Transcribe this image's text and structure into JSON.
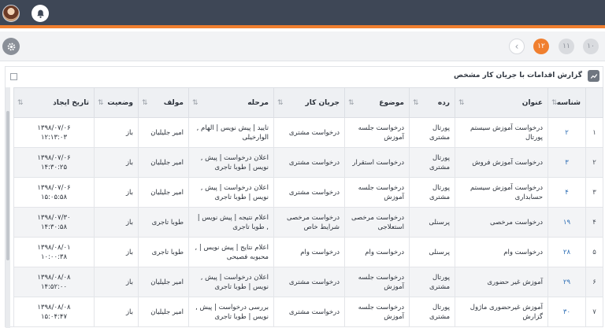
{
  "header": {
    "avatar_icon": "user-avatar-icon",
    "notification_icon": "bell-icon"
  },
  "toolbar": {
    "settings_icon": "gear-icon",
    "pagination": {
      "back": "‹",
      "pages": [
        "۱۲",
        "۱۱",
        "۱۰"
      ],
      "active_page": "۱۲"
    }
  },
  "report": {
    "title": "گزارش اقدامات با جریان کار مشخص",
    "columns": {
      "id": "شناسه",
      "title": "عنوان",
      "category": "رده",
      "subject": "موضوع",
      "workflow": "جریان کار",
      "stage": "مرحله",
      "author": "مولف",
      "status": "وضعیت",
      "created": "تاریخ ایجاد"
    },
    "rows": [
      {
        "rn": "۱",
        "id": "۲",
        "title": "درخواست آموزش سیستم پورتال",
        "category": "پورتال مشتری",
        "subject": "درخواست جلسه آموزش",
        "workflow": "درخواست مشتری",
        "stage": "تایید | پیش نویس | الهام , الوارخیلی",
        "author": "امیر جلیلیان",
        "status": "باز",
        "date": "۱۳۹۸/۰۷/۰۶",
        "time": "۱۲:۱۳:۰۳"
      },
      {
        "rn": "۲",
        "id": "۳",
        "title": "درخواست آموزش فروش",
        "category": "پورتال مشتری",
        "subject": "درخواست استقرار",
        "workflow": "درخواست مشتری",
        "stage": "اعلان درخواست | پیش , نویس | طوبا تاجری",
        "author": "امیر جلیلیان",
        "status": "باز",
        "date": "۱۳۹۸/۰۷/۰۶",
        "time": "۱۴:۳۰:۲۵"
      },
      {
        "rn": "۳",
        "id": "۴",
        "title": "درخواست آموزش سیستم حسابداری",
        "category": "پورتال مشتری",
        "subject": "درخواست جلسه آموزش",
        "workflow": "درخواست مشتری",
        "stage": "اعلان درخواست | پیش , نویس | طوبا تاجری",
        "author": "امیر جلیلیان",
        "status": "باز",
        "date": "۱۳۹۸/۰۷/۰۶",
        "time": "۱۵:۰۵:۵۸"
      },
      {
        "rn": "۴",
        "id": "۱۹",
        "title": "درخواست مرخصی",
        "category": "پرسنلی",
        "subject": "درخواست مرخصی استعلاجی",
        "workflow": "درخواست مرخصی شرایط خاص",
        "stage": "اعلام نتیجه | پیش نویس | , طوبا تاجری",
        "author": "طوبا تاجری",
        "status": "باز",
        "date": "۱۳۹۸/۰۷/۳۰",
        "time": "۱۴:۳۰:۵۸"
      },
      {
        "rn": "۵",
        "id": "۲۸",
        "title": "درخواست وام",
        "category": "پرسنلی",
        "subject": "درخواست وام",
        "workflow": "درخواست وام",
        "stage": "اعلام نتایج | پیش نویس | , محبوبه فصیحی",
        "author": "طوبا تاجری",
        "status": "باز",
        "date": "۱۳۹۸/۰۸/۰۱",
        "time": "۱۰:۰۰:۳۸"
      },
      {
        "rn": "۶",
        "id": "۲۹",
        "title": "آموزش غیر حضوری",
        "category": "پورتال مشتری",
        "subject": "درخواست جلسه آموزش",
        "workflow": "درخواست مشتری",
        "stage": "اعلان درخواست | پیش , نویس | طوبا تاجری",
        "author": "امیر جلیلیان",
        "status": "باز",
        "date": "۱۳۹۸/۰۸/۰۸",
        "time": "۱۴:۵۲:۰۰"
      },
      {
        "rn": "۷",
        "id": "۳۰",
        "title": "آموزش غیرحضوری ماژول گزارش",
        "category": "پورتال مشتری",
        "subject": "درخواست جلسه آموزش",
        "workflow": "درخواست مشتری",
        "stage": "بررسی درخواست | پیش , نویس | طوبا تاجری",
        "author": "امیر جلیلیان",
        "status": "باز",
        "date": "۱۳۹۸/۰۸/۰۸",
        "time": "۱۵:۰۴:۴۷"
      }
    ]
  }
}
